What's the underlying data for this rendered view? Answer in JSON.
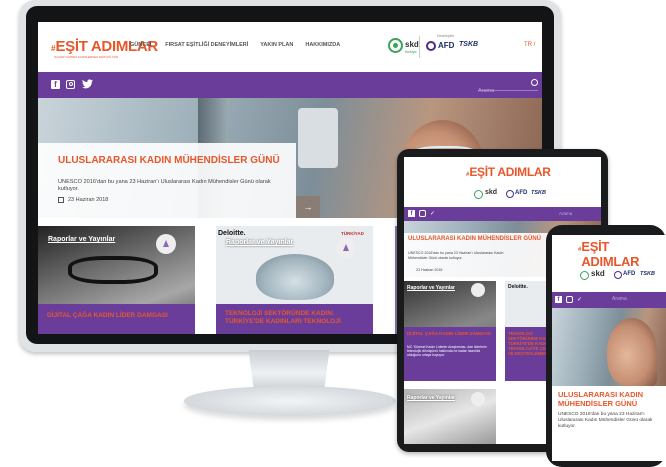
{
  "brand": {
    "logo_hash": "#",
    "logo_text": "EŞİT ADIMLAR",
    "logo_tagline": "İŞ DÜNYASINDA KADIN-ERKEK EŞİTLİĞİ İÇİN",
    "skd_text": "skd",
    "skd_sub": "türkiye",
    "afd_text": "AFD",
    "tsb_text": "TSKB",
    "destek_text": "Destekçiler"
  },
  "nav": {
    "items": [
      "GÜNCEL",
      "FIRSAT EŞİTLİĞİ DENEYİMLERİ",
      "YAKIN PLAN",
      "HAKKIMIZDA"
    ],
    "lang": "TR /"
  },
  "search": {
    "placeholder": "Arama"
  },
  "hero": {
    "title": "ULUSLARARASI KADIN MÜHENDİSLER GÜNÜ",
    "body": "UNESCO 2016'dan bu yana 23 Haziran'ı Uluslararası Kadın Mühendisler Günü olarak kutluyor.",
    "date": "23 Haziran 2018",
    "arrow": "→"
  },
  "cards": [
    {
      "category": "Raporlar ve Yayınlar",
      "title": "DİJİTAL ÇAĞA KADIN LİDER DAMGASI"
    },
    {
      "category": "Raporlar ve Yayınlar",
      "brand_left": "Deloitte.",
      "brand_right": "TÜRKİYAD",
      "title": "TEKNOLOJİ SEKTÖRÜNDE KADIN: TÜRKİYE'DE KADINLARI TEKNOLOJİ"
    }
  ],
  "tablet": {
    "hero_title": "ULUSLARARASI KADIN MÜHENDİSLER GÜNÜ",
    "hero_body": "UNESCO 2016'dan bu yana 23 Haziran'ı Uluslararası Kadın Mühendisler Günü olarak kutluyor.",
    "date": "23 Haziran 2018",
    "category": "Raporlar ve Yayınlar",
    "card1_title": "DİJİTAL ÇAĞA KADIN LİDER DAMGASI",
    "card1_body": "MC 'Küresel Kadın Liderler Araştırması, dan liderlerin teknolojik dönüşümü hakkında ne kadar hazırlıklı olduğunu ortaya koyuyor.",
    "card2_brand": "Deloitte.",
    "card2_title": "TEKNOLOJİ SEKTÖRÜNDE KADIN: TÜRKİYE'DE KADINLARI TEKNOLOJİYE ÇEKMEK VE DESTEKLEMEK",
    "card3_category": "Raporlar ve Yayınlar"
  },
  "phone": {
    "search_placeholder": "Arama",
    "hero_title": "ULUSLARARASI KADIN MÜHENDİSLER GÜNÜ",
    "hero_body": "UNESCO 2016'dan bu yana 23 Haziran'ı Uluslararası Kadın Mühendisler Günü olarak kutluyor."
  },
  "colors": {
    "accent_orange": "#e8572b",
    "brand_purple": "#6a3d9b"
  },
  "icons": [
    "facebook-icon",
    "instagram-icon",
    "twitter-icon",
    "search-icon",
    "calendar-icon",
    "arrow-right-icon",
    "female-icon"
  ]
}
